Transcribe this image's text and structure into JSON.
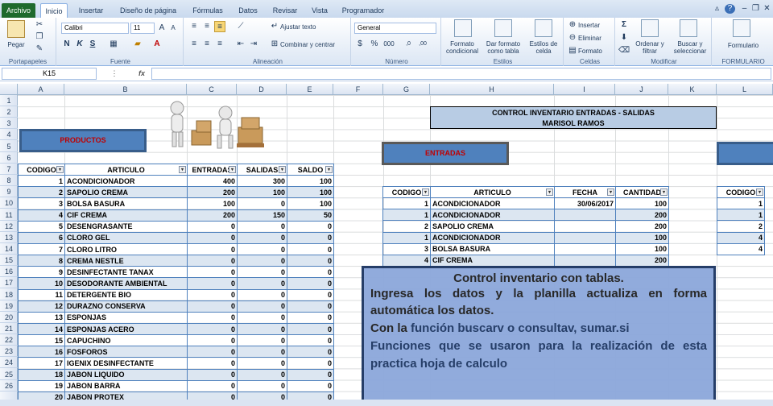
{
  "ribbon_tabs": [
    "Archivo",
    "Inicio",
    "Insertar",
    "Diseño de página",
    "Fórmulas",
    "Datos",
    "Revisar",
    "Vista",
    "Programador"
  ],
  "ribbon": {
    "paste": "Pegar",
    "clipboard": "Portapapeles",
    "font_name": "Calibri",
    "font_size": "11",
    "font_group": "Fuente",
    "wrap": "Ajustar texto",
    "merge": "Combinar y centrar",
    "align_group": "Alineación",
    "number_format": "General",
    "number_group": "Número",
    "cond_format": "Formato condicional",
    "table_format": "Dar formato como tabla",
    "cell_styles": "Estilos de celda",
    "styles_group": "Estilos",
    "insert": "Insertar",
    "delete": "Eliminar",
    "format": "Formato",
    "cells_group": "Celdas",
    "sort": "Ordenar y filtrar",
    "find": "Buscar y seleccionar",
    "modify_group": "Modificar",
    "form": "Formulario",
    "form_group": "FORMULARIO"
  },
  "namebox": "K15",
  "columns": [
    "A",
    "B",
    "C",
    "D",
    "E",
    "F",
    "G",
    "H",
    "I",
    "J",
    "K",
    "L"
  ],
  "rows": [
    "1",
    "2",
    "3",
    "4",
    "5",
    "6",
    "7",
    "8",
    "9",
    "10",
    "11",
    "12",
    "13",
    "14",
    "15",
    "16",
    "17",
    "18",
    "19",
    "20",
    "21",
    "22",
    "23",
    "24",
    "25",
    "26"
  ],
  "title": {
    "line1": "CONTROL INVENTARIO ENTRADAS - SALIDAS",
    "line2": "MARISOL RAMOS"
  },
  "productos_label": "PRODUCTOS",
  "entradas_label": "ENTRADAS",
  "products": {
    "headers": [
      "CODIGO",
      "ARTICULO",
      "ENTRADAS",
      "SALIDAS",
      "SALDO"
    ],
    "rows": [
      [
        "1",
        "ACONDICIONADOR",
        "400",
        "300",
        "100"
      ],
      [
        "2",
        "SAPOLIO CREMA",
        "200",
        "100",
        "100"
      ],
      [
        "3",
        "BOLSA BASURA",
        "100",
        "0",
        "100"
      ],
      [
        "4",
        "CIF CREMA",
        "200",
        "150",
        "50"
      ],
      [
        "5",
        "DESENGRASANTE",
        "0",
        "0",
        "0"
      ],
      [
        "6",
        "CLORO GEL",
        "0",
        "0",
        "0"
      ],
      [
        "7",
        "CLORO LITRO",
        "0",
        "0",
        "0"
      ],
      [
        "8",
        "CREMA NESTLE",
        "0",
        "0",
        "0"
      ],
      [
        "9",
        "DESINFECTANTE TANAX",
        "0",
        "0",
        "0"
      ],
      [
        "10",
        "DESODORANTE AMBIENTAL",
        "0",
        "0",
        "0"
      ],
      [
        "11",
        "DETERGENTE BIO",
        "0",
        "0",
        "0"
      ],
      [
        "12",
        "DURAZNO CONSERVA",
        "0",
        "0",
        "0"
      ],
      [
        "13",
        "ESPONJAS",
        "0",
        "0",
        "0"
      ],
      [
        "14",
        "ESPONJAS ACERO",
        "0",
        "0",
        "0"
      ],
      [
        "15",
        "CAPUCHINO",
        "0",
        "0",
        "0"
      ],
      [
        "16",
        "FOSFOROS",
        "0",
        "0",
        "0"
      ],
      [
        "17",
        "IGENIX DESINFECTANTE",
        "0",
        "0",
        "0"
      ],
      [
        "18",
        "JABON LIQUIDO",
        "0",
        "0",
        "0"
      ],
      [
        "19",
        "JABON BARRA",
        "0",
        "0",
        "0"
      ],
      [
        "20",
        "JABON PROTEX",
        "0",
        "0",
        "0"
      ]
    ]
  },
  "entradas": {
    "headers": [
      "CODIGO",
      "ARTICULO",
      "FECHA",
      "CANTIDAD"
    ],
    "rows": [
      [
        "1",
        "ACONDICIONADOR",
        "30/06/2017",
        "100"
      ],
      [
        "1",
        "ACONDICIONADOR",
        "",
        "200"
      ],
      [
        "2",
        "SAPOLIO CREMA",
        "",
        "200"
      ],
      [
        "1",
        "ACONDICIONADOR",
        "",
        "100"
      ],
      [
        "3",
        "BOLSA BASURA",
        "",
        "100"
      ],
      [
        "4",
        "CIF CREMA",
        "",
        "200"
      ]
    ]
  },
  "salidas": {
    "header": "CODIGO",
    "codes": [
      "1",
      "1",
      "2",
      "4",
      "4"
    ]
  },
  "overlay": {
    "title": "Control inventario con tablas.",
    "line1": "Ingresa los datos y la planilla actualiza en forma automática los datos.",
    "line2a": "Con la ",
    "line2b": "función buscarv o consultav, sumar.si",
    "line3": "Funciones que se usaron para la realización de esta practica hoja de calculo"
  }
}
